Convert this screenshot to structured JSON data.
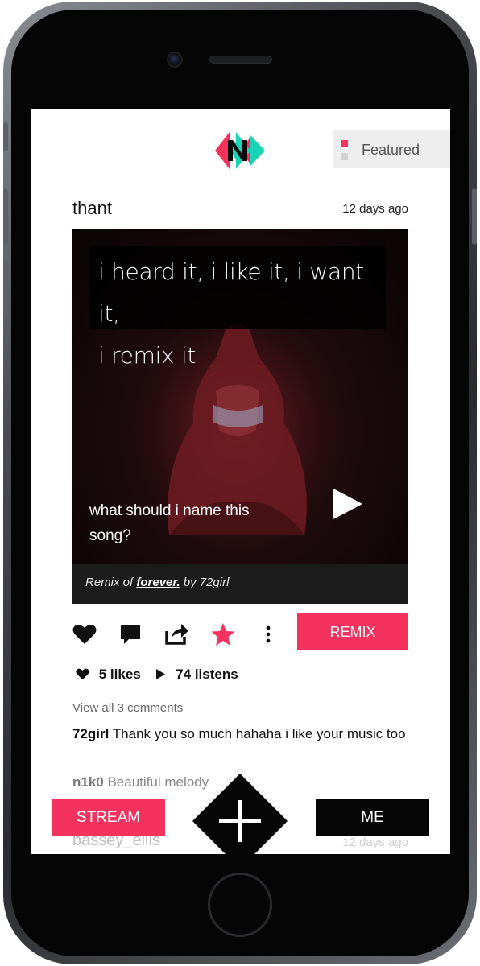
{
  "header": {
    "featured_label": "Featured"
  },
  "post": {
    "author": "thant",
    "time": "12 days ago",
    "quote_line1": "i heard it, i like it, i want it,",
    "quote_line2": "i remix it",
    "question": "what should i name this song?",
    "remix_prefix": "Remix of ",
    "remix_title": "forever.",
    "remix_suffix": " by 72girl",
    "remix_button": "REMIX",
    "likes": "5 likes",
    "listens": "74 listens",
    "view_all": "View all 3 comments",
    "comments": [
      {
        "user": "72girl",
        "text": " Thank you so much hahaha i like your music too"
      },
      {
        "user": "n1k0",
        "text": " Beautiful melody"
      }
    ]
  },
  "next_post": {
    "author": "bassey_ellis",
    "time": "12 days ago"
  },
  "bottom_nav": {
    "stream_label": "STREAM",
    "me_label": "ME"
  },
  "colors": {
    "accent": "#f4325e",
    "teal": "#19d3b5",
    "dark": "#050505"
  },
  "icons": [
    "logo-icon",
    "heart-icon",
    "comment-icon",
    "share-icon",
    "star-icon",
    "more-icon",
    "play-icon",
    "plus-icon"
  ]
}
